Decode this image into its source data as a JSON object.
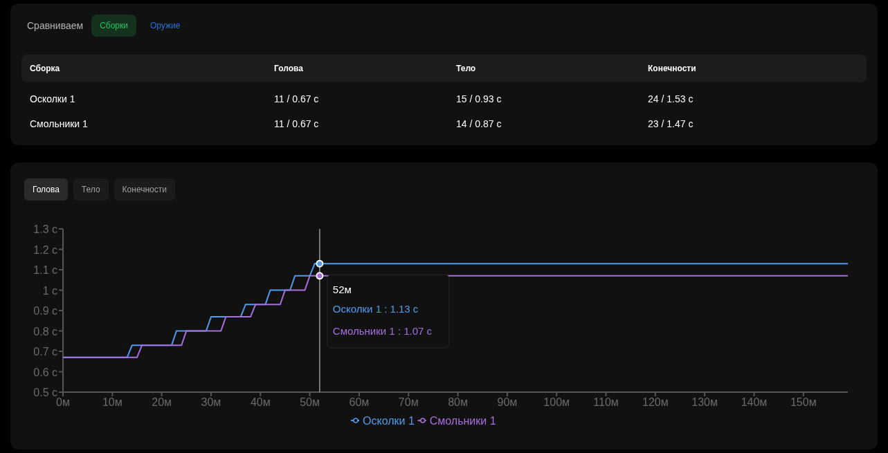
{
  "compare": {
    "label": "Сравниваем",
    "toggles": [
      {
        "label": "Сборки",
        "selected": true
      },
      {
        "label": "Оружие",
        "selected": false
      }
    ]
  },
  "table": {
    "columns": [
      "Сборка",
      "Голова",
      "Тело",
      "Конечности"
    ],
    "rows": [
      [
        "Осколки 1",
        "11 / 0.67 с",
        "15 / 0.93 с",
        "24 / 1.53 с"
      ],
      [
        "Смольники 1",
        "11 / 0.67 с",
        "14 / 0.87 с",
        "23 / 1.47 с"
      ]
    ]
  },
  "chart_tabs": [
    {
      "label": "Голова",
      "selected": true
    },
    {
      "label": "Тело",
      "selected": false
    },
    {
      "label": "Конечности",
      "selected": false
    }
  ],
  "chart_data": {
    "type": "line",
    "x": [
      0,
      13,
      14,
      15,
      16,
      22,
      23,
      24,
      25,
      29,
      30,
      32,
      33,
      36,
      37,
      38,
      39,
      41,
      42,
      44,
      45,
      46,
      47,
      49,
      50,
      51,
      52,
      159
    ],
    "series": [
      {
        "name": "Осколки 1",
        "color": "#4f9cf0",
        "values": [
          0.67,
          0.67,
          0.73,
          0.73,
          0.73,
          0.73,
          0.8,
          0.8,
          0.8,
          0.8,
          0.87,
          0.87,
          0.87,
          0.87,
          0.93,
          0.93,
          0.93,
          0.93,
          1.0,
          1.0,
          1.0,
          1.0,
          1.07,
          1.07,
          1.07,
          1.13,
          1.13,
          1.13
        ]
      },
      {
        "name": "Смольники 1",
        "color": "#a86ee0",
        "values": [
          0.67,
          0.67,
          0.67,
          0.67,
          0.73,
          0.73,
          0.73,
          0.73,
          0.8,
          0.8,
          0.8,
          0.8,
          0.87,
          0.87,
          0.87,
          0.87,
          0.93,
          0.93,
          0.93,
          0.93,
          1.0,
          1.0,
          1.0,
          1.0,
          1.07,
          1.07,
          1.07,
          1.07
        ]
      }
    ],
    "xlim": [
      0,
      159
    ],
    "ylim": [
      0.5,
      1.3
    ],
    "xticks": [
      {
        "value": 0,
        "label": "0м"
      },
      {
        "value": 10,
        "label": "10м"
      },
      {
        "value": 20,
        "label": "20м"
      },
      {
        "value": 30,
        "label": "30м"
      },
      {
        "value": 40,
        "label": "40м"
      },
      {
        "value": 50,
        "label": "50м"
      },
      {
        "value": 60,
        "label": "60м"
      },
      {
        "value": 70,
        "label": "70м"
      },
      {
        "value": 80,
        "label": "80м"
      },
      {
        "value": 90,
        "label": "90м"
      },
      {
        "value": 100,
        "label": "100м"
      },
      {
        "value": 110,
        "label": "110м"
      },
      {
        "value": 120,
        "label": "120м"
      },
      {
        "value": 130,
        "label": "130м"
      },
      {
        "value": 140,
        "label": "140м"
      },
      {
        "value": 150,
        "label": "150м"
      }
    ],
    "yticks": [
      {
        "value": 0.5,
        "label": "0.5 с"
      },
      {
        "value": 0.6,
        "label": "0.6 с"
      },
      {
        "value": 0.7,
        "label": "0.7 с"
      },
      {
        "value": 0.8,
        "label": "0.8 с"
      },
      {
        "value": 0.9,
        "label": "0.9 с"
      },
      {
        "value": 1.0,
        "label": "1 с"
      },
      {
        "value": 1.1,
        "label": "1.1 с"
      },
      {
        "value": 1.2,
        "label": "1.2 с"
      },
      {
        "value": 1.3,
        "label": "1.3 с"
      }
    ],
    "ref_lines": [
      {
        "axis": "x",
        "value": 52
      }
    ],
    "legend": true
  },
  "tooltip": {
    "title": "52м",
    "lines": [
      "Осколки 1 : 1.13 с",
      "Смольники 1 : 1.07 с"
    ]
  }
}
